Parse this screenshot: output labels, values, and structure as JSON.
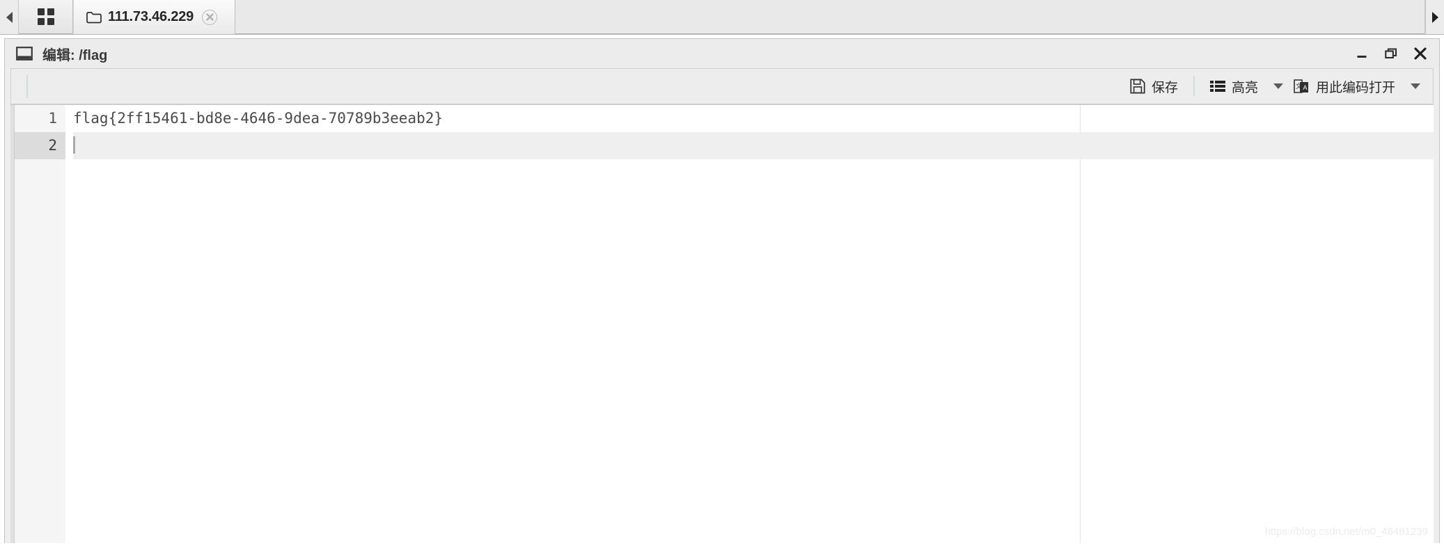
{
  "tabbar": {
    "scroll_left_icon": "chevron-left-icon",
    "scroll_right_icon": "chevron-right-icon",
    "apps_icon": "grid-apps-icon",
    "tabs": [
      {
        "icon": "folder-icon",
        "label": "111.73.46.229",
        "close_icon": "close-circle-icon",
        "active": true
      }
    ]
  },
  "window": {
    "icon": "window-icon",
    "title": "编辑: /flag",
    "controls": [
      {
        "name": "minimize-button",
        "icon": "minimize-icon"
      },
      {
        "name": "restore-button",
        "icon": "restore-icon"
      },
      {
        "name": "close-button",
        "icon": "close-icon"
      }
    ]
  },
  "toolbar": {
    "save": {
      "icon": "floppy-save-icon",
      "label": "保存"
    },
    "highlight": {
      "icon": "list-lines-icon",
      "label": "高亮",
      "caret": "chevron-down-icon"
    },
    "encoding": {
      "icon": "encoding-translate-icon",
      "label": "用此编码打开",
      "caret": "chevron-down-icon"
    }
  },
  "editor": {
    "lines": [
      {
        "number": "1",
        "text": "flag{2ff15461-bd8e-4646-9dea-70789b3eeab2}",
        "active": false
      },
      {
        "number": "2",
        "text": "",
        "active": true
      }
    ],
    "cursor_line": 2,
    "watermark": "https://blog.csdn.net/m0_46481239"
  },
  "colors": {
    "tabbar_bg": "#e8e8e8",
    "window_bg": "#eeeeee",
    "toolbar_bg": "#ededed",
    "editor_bg": "#ffffff",
    "active_line_bg": "#efefef",
    "gutter_bg": "#f5f5f5",
    "text": "#4a4a4a"
  }
}
